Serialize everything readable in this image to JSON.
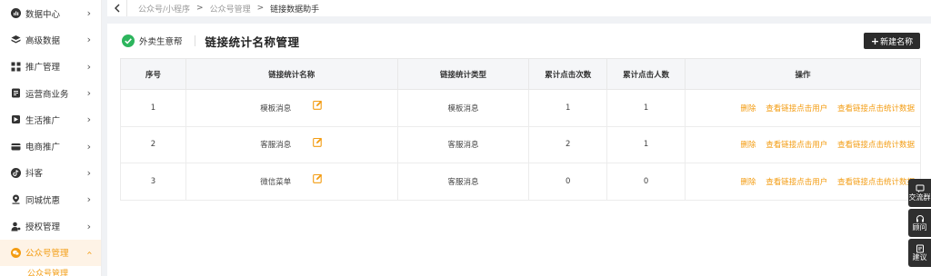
{
  "sidebar": {
    "items": [
      {
        "label": "数据中心",
        "icon": "dashboard-icon"
      },
      {
        "label": "高级数据",
        "icon": "layers-icon"
      },
      {
        "label": "推广管理",
        "icon": "grid-icon"
      },
      {
        "label": "运营商业务",
        "icon": "document-icon"
      },
      {
        "label": "生活推广",
        "icon": "flag-icon"
      },
      {
        "label": "电商推广",
        "icon": "card-icon"
      },
      {
        "label": "抖客",
        "icon": "tiktok-icon"
      },
      {
        "label": "同城优惠",
        "icon": "location-icon"
      },
      {
        "label": "授权管理",
        "icon": "user-key-icon"
      },
      {
        "label": "公众号管理",
        "icon": "wechat-icon"
      }
    ],
    "sub_item": "公众号管理"
  },
  "breadcrumb": {
    "items": [
      "公众号/小程序",
      "公众号管理",
      "链接数据助手"
    ],
    "separator": ">"
  },
  "header": {
    "brand_name": "外卖生意帮",
    "title": "链接统计名称管理",
    "new_button": "新建名称",
    "new_button_plus": "+"
  },
  "table": {
    "columns": [
      "序号",
      "链接统计名称",
      "链接统计类型",
      "累计点击次数",
      "累计点击人数",
      "操作"
    ],
    "rows": [
      {
        "index": "1",
        "name": "模板消息",
        "type": "模板消息",
        "clicks": "1",
        "users": "1"
      },
      {
        "index": "2",
        "name": "客服消息",
        "type": "客服消息",
        "clicks": "2",
        "users": "1"
      },
      {
        "index": "3",
        "name": "微信菜单",
        "type": "客服消息",
        "clicks": "0",
        "users": "0"
      }
    ],
    "actions": [
      "删除",
      "查看链接点击用户",
      "查看链接点击统计数据"
    ]
  },
  "float_tools": [
    {
      "label": "交流群",
      "icon": "chat-group-icon"
    },
    {
      "label": "顾问",
      "icon": "headset-icon"
    },
    {
      "label": "建议",
      "icon": "feedback-icon"
    }
  ],
  "colors": {
    "accent": "#f39c12",
    "brand_green": "#2db55d",
    "dark_button": "#2b2b2b"
  }
}
